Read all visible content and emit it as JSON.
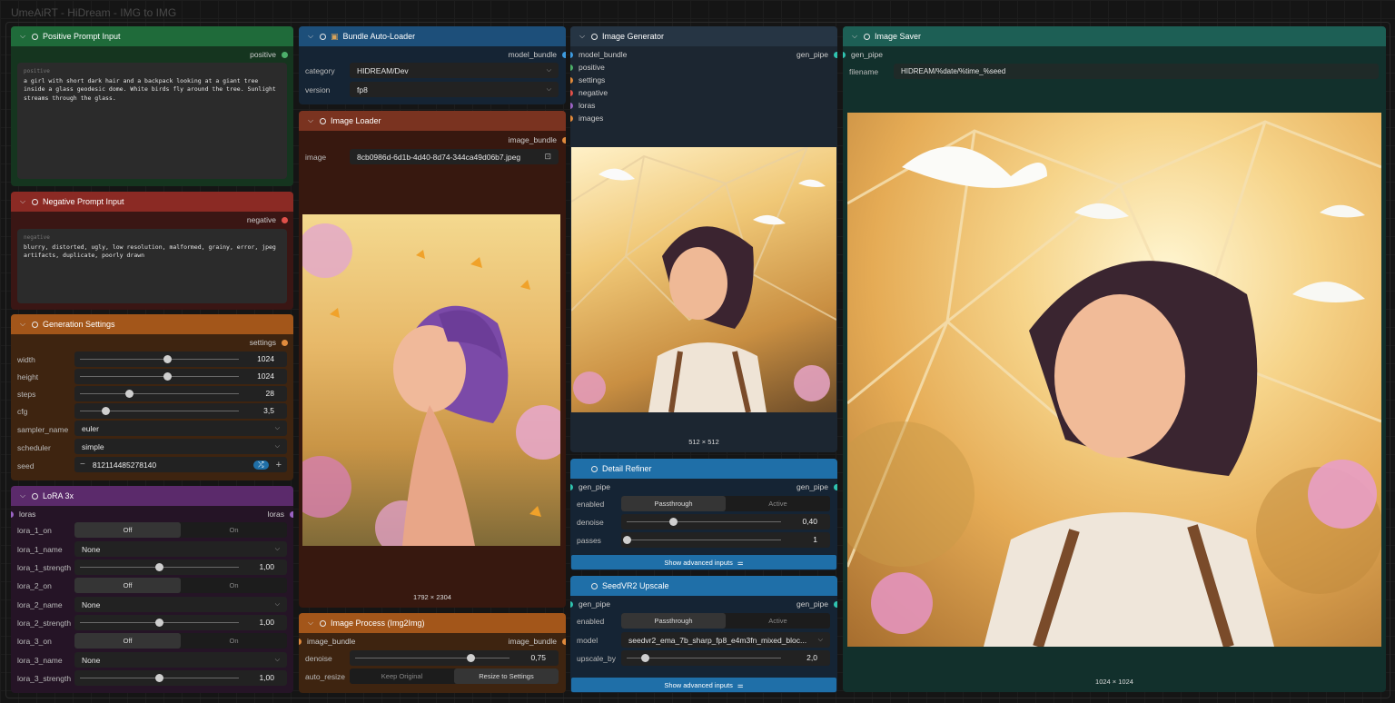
{
  "app": {
    "title": "UmeAiRT - HiDream - IMG to IMG"
  },
  "positive_prompt": {
    "title": "Positive Prompt Input",
    "output": "positive",
    "placeholder": "positive",
    "text": "a girl with short dark hair and a backpack looking at a giant tree inside a glass geodesic dome. White birds fly around the tree. Sunlight streams through the glass."
  },
  "negative_prompt": {
    "title": "Negative Prompt Input",
    "output": "negative",
    "placeholder": "negative",
    "text": "blurry, distorted, ugly, low resolution, malformed, grainy, error, jpeg artifacts, duplicate, poorly drawn"
  },
  "generation_settings": {
    "title": "Generation Settings",
    "output": "settings",
    "width": {
      "label": "width",
      "value": "1024",
      "fraction": 0.55
    },
    "height": {
      "label": "height",
      "value": "1024",
      "fraction": 0.55
    },
    "steps": {
      "label": "steps",
      "value": "28",
      "fraction": 0.31
    },
    "cfg": {
      "label": "cfg",
      "value": "3,5",
      "fraction": 0.16
    },
    "sampler_name": {
      "label": "sampler_name",
      "value": "euler"
    },
    "scheduler": {
      "label": "scheduler",
      "value": "simple"
    },
    "seed": {
      "label": "seed",
      "value": "812114485278140",
      "minus": "−",
      "plus": "+",
      "random": "⤮"
    }
  },
  "lora": {
    "title": "LoRA 3x",
    "input": "loras",
    "output": "loras",
    "off": "Off",
    "on": "On",
    "none": "None",
    "rows": [
      {
        "on_label": "lora_1_on",
        "name_label": "lora_1_name",
        "strength_label": "lora_1_strength",
        "strength": "1,00",
        "fraction": 0.5
      },
      {
        "on_label": "lora_2_on",
        "name_label": "lora_2_name",
        "strength_label": "lora_2_strength",
        "strength": "1,00",
        "fraction": 0.5
      },
      {
        "on_label": "lora_3_on",
        "name_label": "lora_3_name",
        "strength_label": "lora_3_strength",
        "strength": "1,00",
        "fraction": 0.5
      }
    ]
  },
  "bundle_loader": {
    "title": "Bundle Auto-Loader",
    "output": "model_bundle",
    "category_label": "category",
    "category": "HIDREAM/Dev",
    "version_label": "version",
    "version": "fp8"
  },
  "image_loader": {
    "title": "Image Loader",
    "output": "image_bundle",
    "image_label": "image",
    "image": "8cb0986d-6d1b-4d40-8d74-344ca49d06b7.jpeg",
    "size": "1792 × 2304"
  },
  "image_process": {
    "title": "Image Process (Img2Img)",
    "input": "image_bundle",
    "output": "image_bundle",
    "denoise_label": "denoise",
    "denoise": "0,75",
    "denoise_fraction": 0.75,
    "auto_resize_label": "auto_resize",
    "keep_original": "Keep Original",
    "resize_to_settings": "Resize to Settings"
  },
  "image_generator": {
    "title": "Image Generator",
    "input": "model_bundle",
    "output": "gen_pipe",
    "inputs": [
      "positive",
      "settings",
      "negative",
      "loras",
      "images"
    ],
    "size": "512 × 512"
  },
  "detail_refiner": {
    "title": "Detail Refiner",
    "input": "gen_pipe",
    "output": "gen_pipe",
    "enabled_label": "enabled",
    "passthrough": "Passthrough",
    "active": "Active",
    "denoise_label": "denoise",
    "denoise": "0,40",
    "denoise_fraction": 0.3,
    "passes_label": "passes",
    "passes": "1",
    "passes_fraction": 0.0,
    "advanced": "Show advanced inputs"
  },
  "seedvr2": {
    "title": "SeedVR2 Upscale",
    "input": "gen_pipe",
    "output": "gen_pipe",
    "enabled_label": "enabled",
    "passthrough": "Passthrough",
    "active": "Active",
    "model_label": "model",
    "model": "seedvr2_ema_7b_sharp_fp8_e4m3fn_mixed_bloc...",
    "upscale_label": "upscale_by",
    "upscale": "2,0",
    "upscale_fraction": 0.12,
    "advanced": "Show advanced inputs"
  },
  "image_saver": {
    "title": "Image Saver",
    "input": "gen_pipe",
    "filename_label": "filename",
    "filename": "HIDREAM/%date/%time_%seed",
    "size": "1024 × 1024"
  },
  "colors": {
    "positive": "#1f6b3a",
    "negative": "#8b2a24",
    "settings": "#a3561a",
    "lora": "#5b2a6b",
    "bundle": "#1d4f7a",
    "loader": "#7a3320",
    "generator": "#263544",
    "refiner": "#1f6fa8",
    "saver": "#1d5f55"
  }
}
